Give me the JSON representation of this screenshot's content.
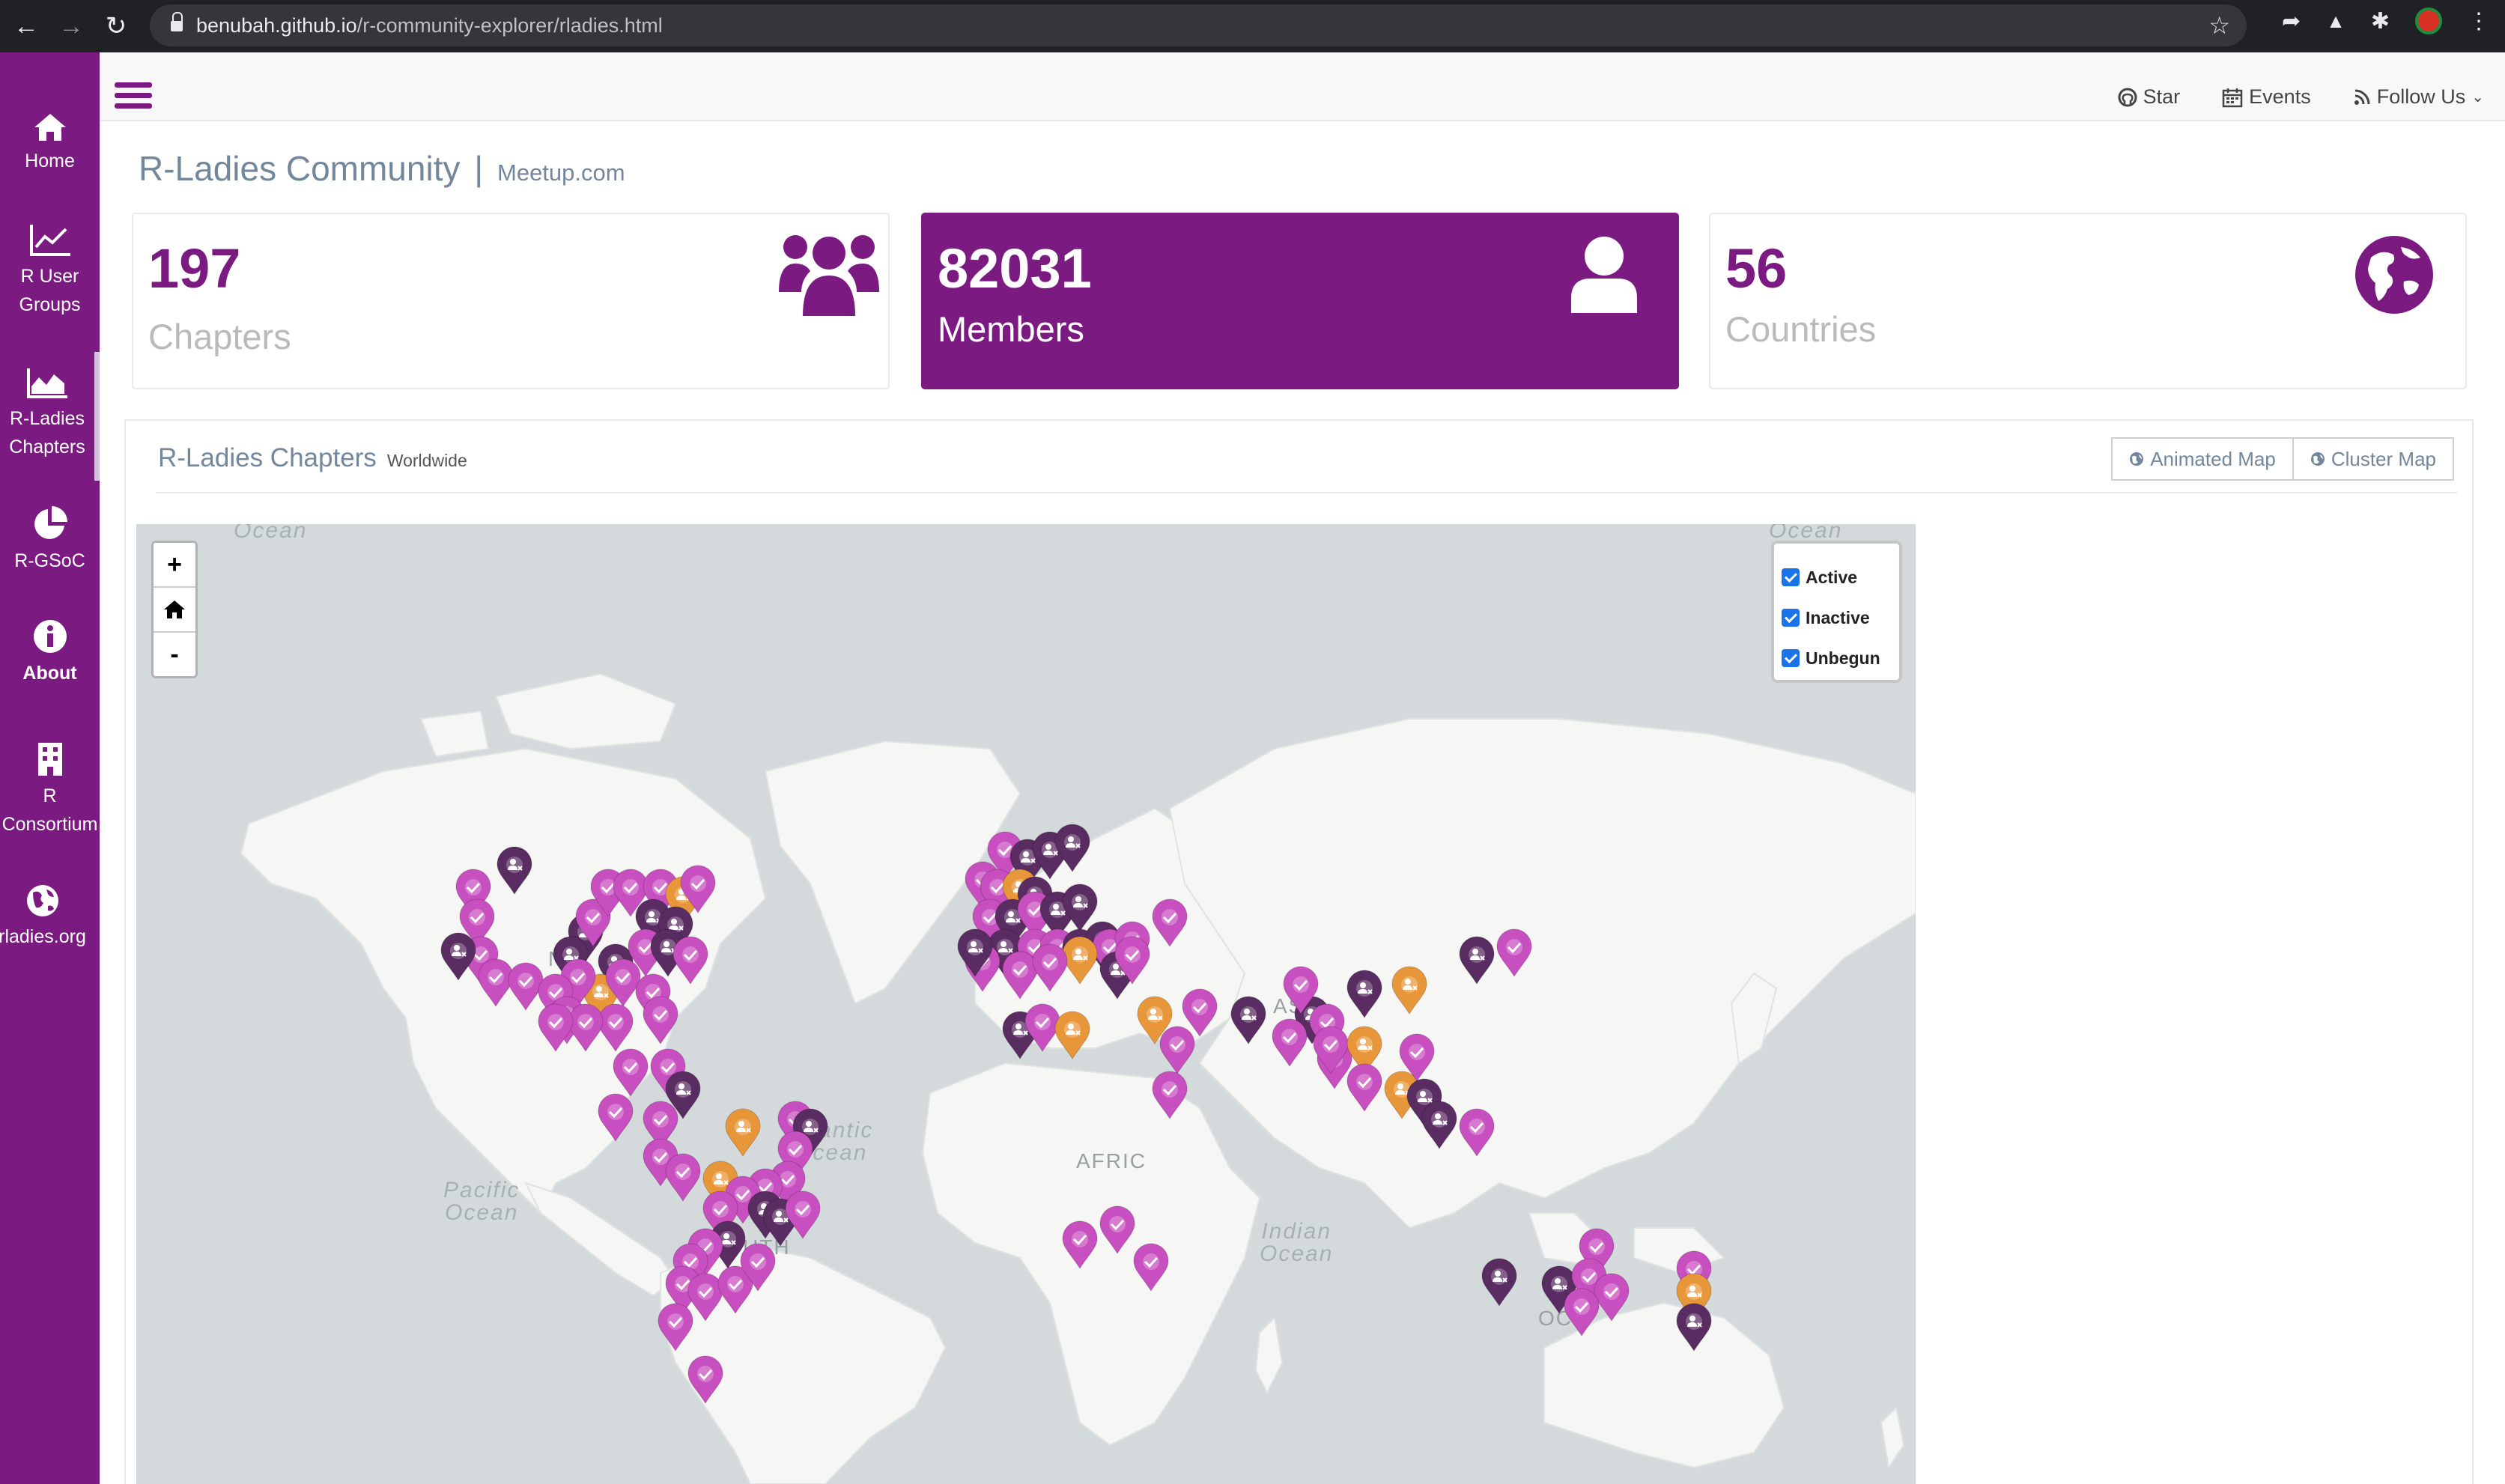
{
  "browser": {
    "url_host": "benubah.github.io",
    "url_path": "/r-community-explorer/rladies.html"
  },
  "sidebar": {
    "items": [
      {
        "label_lines": [
          "Home"
        ]
      },
      {
        "label_lines": [
          "R User",
          "Groups"
        ]
      },
      {
        "label_lines": [
          "R-Ladies",
          "Chapters"
        ]
      },
      {
        "label_lines": [
          "R-GSoC"
        ]
      },
      {
        "label_lines": [
          "About"
        ]
      },
      {
        "label_lines": [
          "R",
          "Consortium"
        ]
      },
      {
        "label_lines": [
          "rladies.org"
        ]
      }
    ]
  },
  "topbar": {
    "links": [
      {
        "label": "Star",
        "icon": "github-icon"
      },
      {
        "label": "Events",
        "icon": "calendar-icon"
      },
      {
        "label": "Follow Us",
        "icon": "rss-icon"
      }
    ]
  },
  "page": {
    "title": "R-Ladies Community",
    "separator": "|",
    "subtitle": "Meetup.com"
  },
  "stats": [
    {
      "value": "197",
      "label": "Chapters",
      "icon": "users-icon"
    },
    {
      "value": "82031",
      "label": "Members",
      "icon": "user-icon"
    },
    {
      "value": "56",
      "label": "Countries",
      "icon": "globe-icon"
    }
  ],
  "panel": {
    "title": "R-Ladies Chapters",
    "subtitle": "Worldwide",
    "buttons": [
      {
        "label": "Animated Map",
        "icon": "globe-icon"
      },
      {
        "label": "Cluster Map",
        "icon": "globe-icon"
      }
    ]
  },
  "map": {
    "zoom_in": "+",
    "zoom_out": "-",
    "legend": [
      {
        "label": "Active",
        "checked": true
      },
      {
        "label": "Inactive",
        "checked": true
      },
      {
        "label": "Unbegun",
        "checked": true
      }
    ],
    "ocean_labels": {
      "nw": "Ocean",
      "ne": "Ocean",
      "atlantic_1": "Atlantic",
      "atlantic_2": "Ocean",
      "pacific_1": "Pacific",
      "pacific_2": "Ocean",
      "indian_1": "Indian",
      "indian_2": "Ocean"
    },
    "continent_labels": {
      "asia": "ASIA",
      "africa": "AFRIC",
      "oceania": "OC",
      "north_america": "NO",
      "south_america_1": "UTH",
      "south_america_2": "A"
    },
    "colors": {
      "active": "#c84fc0",
      "inactive": "#5a2d62",
      "unbegun": "#e8963a"
    }
  }
}
